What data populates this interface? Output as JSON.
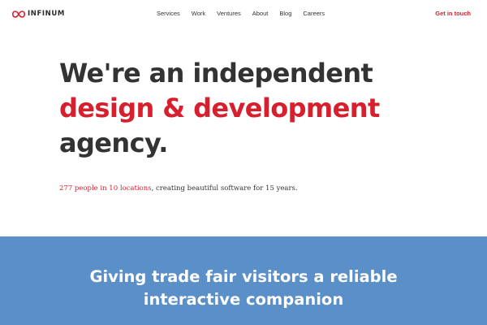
{
  "nav": {
    "logo_text": "INFINUM",
    "logo_icon": "infinity-icon",
    "items": [
      "Services",
      "Work",
      "Ventures",
      "About",
      "Blog",
      "Careers"
    ],
    "cta": "Get in touch"
  },
  "hero": {
    "line1": "We're an independent",
    "line2": "design & development",
    "line3": "agency."
  },
  "tagline": {
    "link": "277 people in 10 locations",
    "rest": ", creating beautiful software for 15 years."
  },
  "banner": {
    "line1": "Giving trade fair visitors a reliable",
    "line2": "interactive companion"
  },
  "colors": {
    "brand_red": "#d6202e",
    "banner_blue": "#5b8fc7",
    "text_dark": "#333333"
  }
}
